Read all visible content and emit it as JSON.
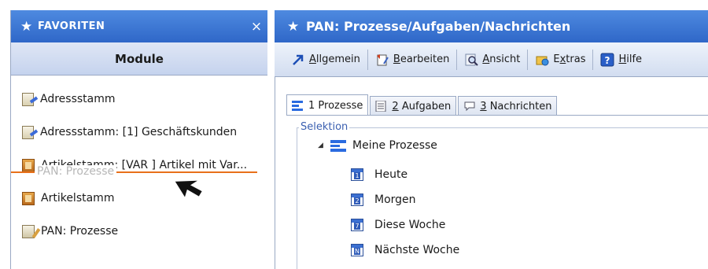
{
  "favorites": {
    "title": "FAVORITEN",
    "close": "×",
    "module_label": "Module",
    "items": [
      {
        "label": "Adressstamm",
        "icon": "address-card-icon"
      },
      {
        "label": "Adressstamm: [1] Geschäftskunden",
        "icon": "address-card-icon"
      },
      {
        "label": "Artikelstamm: [VAR  ] Artikel mit Var...",
        "icon": "article-box-icon"
      },
      {
        "label": "Artikelstamm",
        "icon": "article-box-icon"
      },
      {
        "label": "PAN: Prozesse",
        "icon": "process-icon"
      }
    ],
    "drag_ghost": "PAN: Prozesse"
  },
  "window": {
    "title": "PAN: Prozesse/Aufgaben/Nachrichten"
  },
  "toolbar": {
    "allgemein_rest": "llgemein",
    "allgemein_u": "A",
    "bearbeiten_u": "B",
    "bearbeiten_rest": "earbeiten",
    "ansicht_u": "A",
    "ansicht_rest": "nsicht",
    "extras_pre": "E",
    "extras_u": "x",
    "extras_rest": "tras",
    "hilfe_u": "H",
    "hilfe_rest": "ilfe"
  },
  "tabs": [
    {
      "num": "1",
      "label": "Prozesse",
      "active": true
    },
    {
      "num": "2",
      "label": "Aufgaben",
      "active": false
    },
    {
      "num": "3",
      "label": "Nachrichten",
      "active": false
    }
  ],
  "selection": {
    "label": "Selektion",
    "root": "Meine Prozesse",
    "nodes": [
      {
        "label": "Heute",
        "glyph": "1"
      },
      {
        "label": "Morgen",
        "glyph": "2"
      },
      {
        "label": "Diese Woche",
        "glyph": "7"
      },
      {
        "label": "Nächste Woche",
        "glyph": "N"
      }
    ]
  },
  "colors": {
    "header_blue": "#2f67c8",
    "drop_indicator": "#e8701a",
    "selection_label": "#3a5fb0"
  }
}
